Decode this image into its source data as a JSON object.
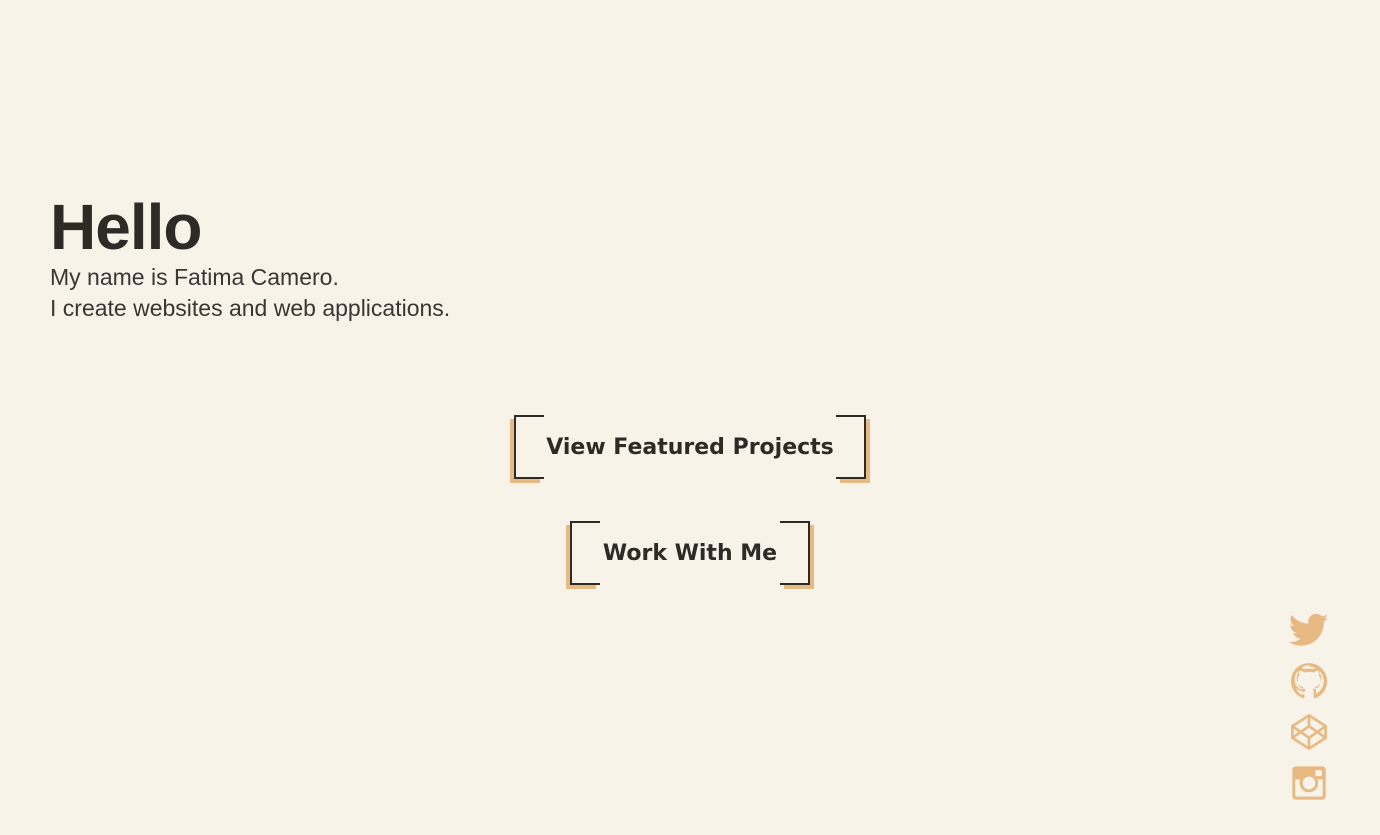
{
  "hero": {
    "heading": "Hello",
    "line1": "My name is Fatima Camero.",
    "line2": "I create websites and web applications."
  },
  "buttons": {
    "projects_label": "View Featured Projects",
    "work_label": "Work With Me"
  },
  "social": [
    {
      "name": "twitter-icon"
    },
    {
      "name": "github-icon"
    },
    {
      "name": "codepen-icon"
    },
    {
      "name": "instagram-icon"
    }
  ],
  "colors": {
    "background": "#f8f3e9",
    "text": "#2e2b27",
    "accent": "#e7b983"
  }
}
